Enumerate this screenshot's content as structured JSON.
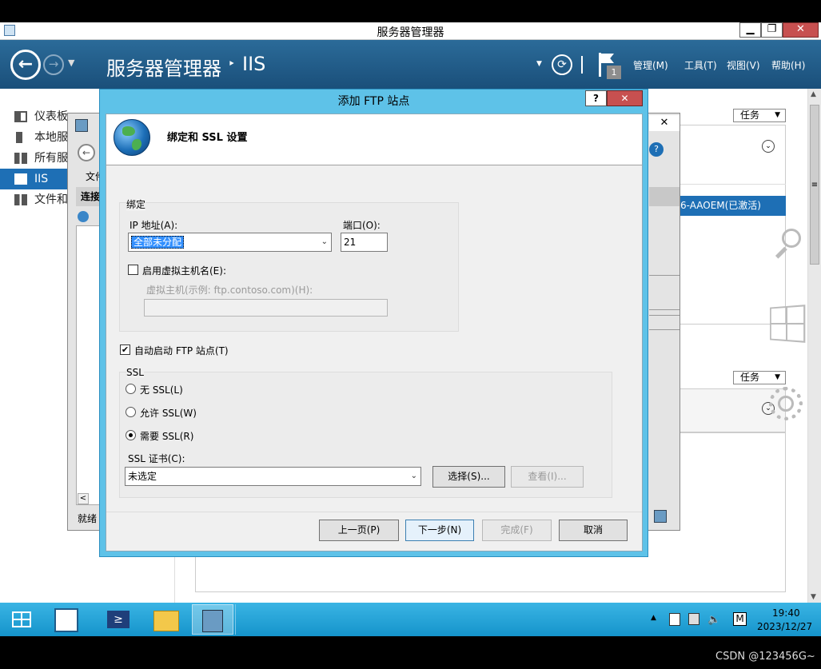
{
  "window": {
    "title": "服务器管理器",
    "min": "▁",
    "max": "❐",
    "close": "✕"
  },
  "header": {
    "breadcrumb_app": "服务器管理器",
    "breadcrumb_sep": "‣",
    "breadcrumb_page": "IIS",
    "notification_count": "1",
    "menus": [
      "管理(M)",
      "工具(T)",
      "视图(V)",
      "帮助(H)"
    ]
  },
  "sidebar": {
    "items": [
      {
        "label": "仪表板",
        "icon": "dashboard-icon"
      },
      {
        "label": "本地服",
        "icon": "local-server-icon"
      },
      {
        "label": "所有服",
        "icon": "all-servers-icon"
      },
      {
        "label": "IIS",
        "icon": "iis-icon"
      },
      {
        "label": "文件和",
        "icon": "file-storage-icon"
      }
    ]
  },
  "main": {
    "tasks_label_1": "任务",
    "tasks_label_2": "任务",
    "server_row": "6-AAOEM(已激活)"
  },
  "iis_manager": {
    "menu_file": "文件",
    "connections": "连接",
    "status": "就绪"
  },
  "dialog": {
    "title": "添加 FTP 站点",
    "help": "?",
    "close": "✕",
    "heading": "绑定和 SSL 设置",
    "binding_group": "绑定",
    "ip_label": "IP 地址(A):",
    "ip_value": "全部未分配",
    "port_label": "端口(O):",
    "port_value": "21",
    "virtual_host_checkbox": "启用虚拟主机名(E):",
    "virtual_host_label": "虚拟主机(示例: ftp.contoso.com)(H):",
    "virtual_host_value": "",
    "autostart_checkbox": "自动启动 FTP 站点(T)",
    "autostart_checked": true,
    "ssl_group": "SSL",
    "ssl_options": [
      "无 SSL(L)",
      "允许 SSL(W)",
      "需要 SSL(R)"
    ],
    "ssl_selected": "需要 SSL(R)",
    "cert_label": "SSL 证书(C):",
    "cert_value": "未选定",
    "select_button": "选择(S)...",
    "view_button": "查看(I)...",
    "prev_button": "上一页(P)",
    "next_button": "下一步(N)",
    "finish_button": "完成(F)",
    "cancel_button": "取消"
  },
  "taskbar": {
    "time": "19:40",
    "date": "2023/12/27",
    "ime": "M"
  },
  "watermark": "CSDN @123456G~",
  "colors": {
    "accent": "#1e6fb5",
    "dialog_frame": "#5ec2e8",
    "taskbar": "#1aa1d8",
    "header": "#1f5c8a"
  }
}
